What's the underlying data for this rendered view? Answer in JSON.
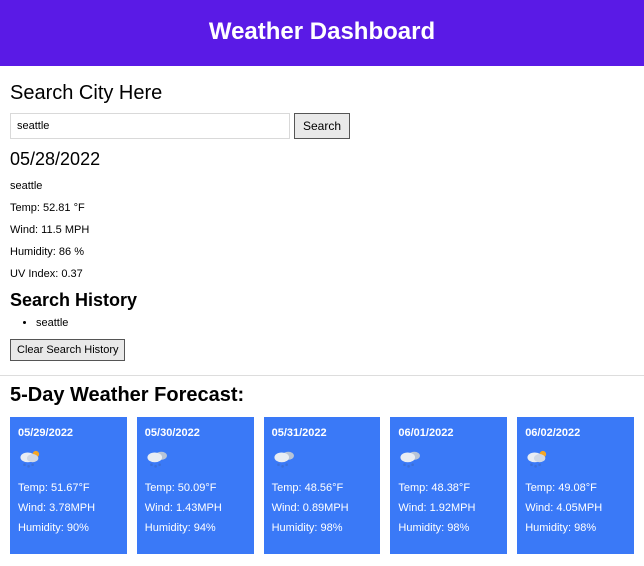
{
  "header": {
    "title": "Weather Dashboard"
  },
  "search": {
    "title": "Search City Here",
    "input_value": "seattle",
    "button_label": "Search"
  },
  "current": {
    "date": "05/28/2022",
    "city": "seattle",
    "temp": "Temp: 52.81 °F",
    "wind": "Wind: 11.5 MPH",
    "humidity": "Humidity: 86 %",
    "uv": "UV Index: 0.37"
  },
  "history": {
    "title": "Search History",
    "items": [
      "seattle"
    ],
    "clear_label": "Clear Search History"
  },
  "forecast": {
    "title": "5-Day Weather Forecast:",
    "days": [
      {
        "date": "05/29/2022",
        "icon": "rain-sun-icon",
        "temp": "Temp: 51.67°F",
        "wind": "Wind: 3.78MPH",
        "humidity": "Humidity: 90%"
      },
      {
        "date": "05/30/2022",
        "icon": "rain-cloud-icon",
        "temp": "Temp: 50.09°F",
        "wind": "Wind: 1.43MPH",
        "humidity": "Humidity: 94%"
      },
      {
        "date": "05/31/2022",
        "icon": "rain-cloud-icon",
        "temp": "Temp: 48.56°F",
        "wind": "Wind: 0.89MPH",
        "humidity": "Humidity: 98%"
      },
      {
        "date": "06/01/2022",
        "icon": "rain-cloud-icon",
        "temp": "Temp: 48.38°F",
        "wind": "Wind: 1.92MPH",
        "humidity": "Humidity: 98%"
      },
      {
        "date": "06/02/2022",
        "icon": "rain-sun-icon",
        "temp": "Temp: 49.08°F",
        "wind": "Wind: 4.05MPH",
        "humidity": "Humidity: 98%"
      }
    ]
  }
}
